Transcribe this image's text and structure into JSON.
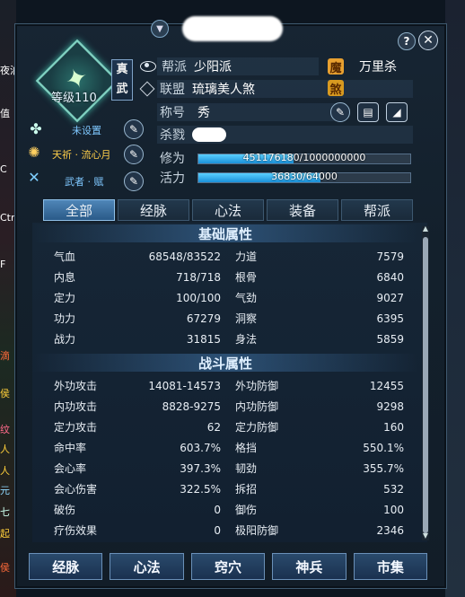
{
  "window": {
    "name_blurred": "",
    "help_label": "?",
    "close_label": "✕"
  },
  "character": {
    "level": "等级110",
    "badge": "真武"
  },
  "side": {
    "link1": "未设置",
    "link2": "天祈 · 流心月",
    "link3": "武者 · 赋"
  },
  "info": {
    "guild_label": "帮派",
    "guild_value": "少阳派",
    "alliance_label": "联盟",
    "alliance_value": "琉璃美人煞",
    "title_label": "称号",
    "title_value": "秀",
    "kill_label": "杀戮",
    "mo_icon": "魔",
    "mo_value": "万里杀",
    "sha_icon": "煞"
  },
  "bars": {
    "xiuwei_label": "修为",
    "xiuwei_text": "451176180/1000000000",
    "xiuwei_fraction": 0.451,
    "huoli_label": "活力",
    "huoli_text": "36830/64000",
    "huoli_fraction": 0.575
  },
  "tabs": [
    "全部",
    "经脉",
    "心法",
    "装备",
    "帮派"
  ],
  "basic": {
    "title": "基础属性",
    "rows": [
      [
        "气血",
        "68548/83522",
        "力道",
        "7579"
      ],
      [
        "内息",
        "718/718",
        "根骨",
        "6840"
      ],
      [
        "定力",
        "100/100",
        "气劲",
        "9027"
      ],
      [
        "功力",
        "67279",
        "洞察",
        "6395"
      ],
      [
        "战力",
        "31815",
        "身法",
        "5859"
      ]
    ]
  },
  "combat": {
    "title": "战斗属性",
    "rows": [
      [
        "外功攻击",
        "14081-14573",
        "外功防御",
        "12455"
      ],
      [
        "内功攻击",
        "8828-9275",
        "内功防御",
        "9298"
      ],
      [
        "定力攻击",
        "62",
        "定力防御",
        "160"
      ],
      [
        "命中率",
        "603.7%",
        "格挡",
        "550.1%"
      ],
      [
        "会心率",
        "397.3%",
        "韧劲",
        "355.7%"
      ],
      [
        "会心伤害",
        "322.5%",
        "拆招",
        "532"
      ],
      [
        "破伤",
        "0",
        "御伤",
        "100"
      ],
      [
        "疗伤效果",
        "0",
        "极阳防御",
        "2346"
      ]
    ]
  },
  "bottom_buttons": [
    "经脉",
    "心法",
    "窍穴",
    "神兵",
    "市集"
  ],
  "left_edge": [
    "夜泊",
    "值",
    "C",
    "Ctr",
    "F",
    "滴",
    "侯",
    "纹",
    "人",
    "人",
    "元",
    "七",
    "起",
    "侯"
  ]
}
